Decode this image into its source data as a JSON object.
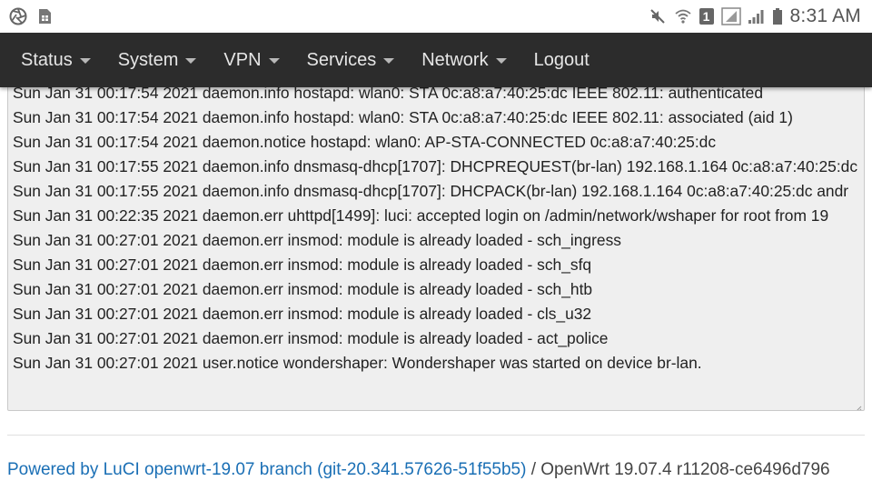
{
  "status_bar": {
    "time": "8:31 AM",
    "left_icons": [
      "aperture-icon",
      "sim-card-icon"
    ],
    "right_icons": [
      "mute-icon",
      "wifi-icon",
      "sim1-icon",
      "signal-icon",
      "signal-icon",
      "battery-icon"
    ],
    "sim_label": "1"
  },
  "nav": {
    "items": [
      {
        "label": "Status",
        "dropdown": true
      },
      {
        "label": "System",
        "dropdown": true
      },
      {
        "label": "VPN",
        "dropdown": true
      },
      {
        "label": "Services",
        "dropdown": true
      },
      {
        "label": "Network",
        "dropdown": true
      },
      {
        "label": "Logout",
        "dropdown": false
      }
    ]
  },
  "log": {
    "lines": [
      "Sun Jan 31 00:17:54 2021 daemon.info hostapd: wlan0: STA 0c:a8:a7:40:25:dc IEEE 802.11: authenticated",
      "Sun Jan 31 00:17:54 2021 daemon.info hostapd: wlan0: STA 0c:a8:a7:40:25:dc IEEE 802.11: associated (aid 1)",
      "Sun Jan 31 00:17:54 2021 daemon.notice hostapd: wlan0: AP-STA-CONNECTED 0c:a8:a7:40:25:dc",
      "Sun Jan 31 00:17:55 2021 daemon.info dnsmasq-dhcp[1707]: DHCPREQUEST(br-lan) 192.168.1.164 0c:a8:a7:40:25:dc",
      "Sun Jan 31 00:17:55 2021 daemon.info dnsmasq-dhcp[1707]: DHCPACK(br-lan) 192.168.1.164 0c:a8:a7:40:25:dc andr",
      "Sun Jan 31 00:22:35 2021 daemon.err uhttpd[1499]: luci: accepted login on /admin/network/wshaper for root from 19",
      "Sun Jan 31 00:27:01 2021 daemon.err insmod: module is already loaded - sch_ingress",
      "Sun Jan 31 00:27:01 2021 daemon.err insmod: module is already loaded - sch_sfq",
      "Sun Jan 31 00:27:01 2021 daemon.err insmod: module is already loaded - sch_htb",
      "Sun Jan 31 00:27:01 2021 daemon.err insmod: module is already loaded - cls_u32",
      "Sun Jan 31 00:27:01 2021 daemon.err insmod: module is already loaded - act_police",
      "Sun Jan 31 00:27:01 2021 user.notice wondershaper: Wondershaper was started on device br-lan."
    ]
  },
  "footer": {
    "powered_by": "Powered by LuCI openwrt-19.07 branch (git-20.341.57626-51f55b5)",
    "separator": " / ",
    "version": "OpenWrt 19.07.4 r11208-ce6496d796"
  },
  "colors": {
    "navbar_bg": "#2c2c2c",
    "link": "#1a6fb5",
    "log_bg": "#efefef"
  }
}
